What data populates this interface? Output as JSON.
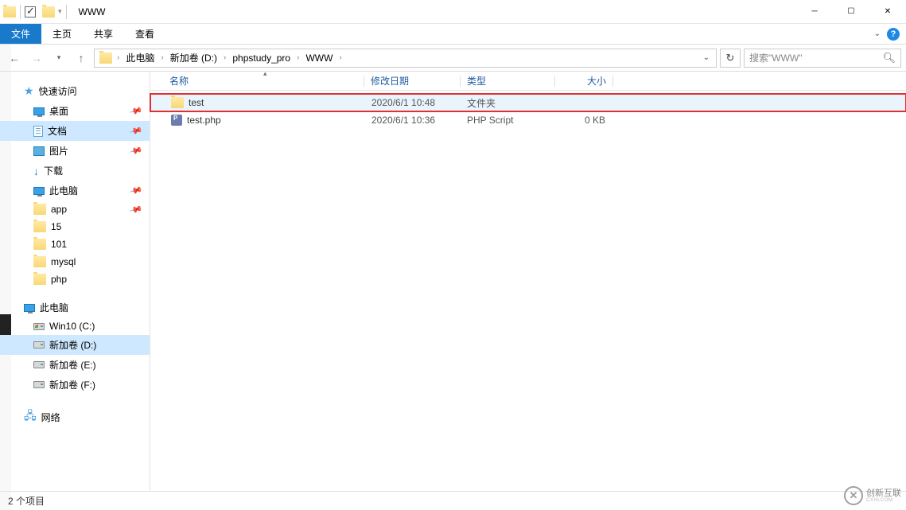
{
  "window": {
    "title": "WWW"
  },
  "ribbon": {
    "file": "文件",
    "tabs": [
      "主页",
      "共享",
      "查看"
    ]
  },
  "breadcrumbs": [
    "此电脑",
    "新加卷 (D:)",
    "phpstudy_pro",
    "WWW"
  ],
  "search": {
    "placeholder": "搜索\"WWW\""
  },
  "nav": {
    "quick_access": "快速访问",
    "quick_items": [
      {
        "label": "桌面",
        "icon": "monitor",
        "pinned": true
      },
      {
        "label": "文档",
        "icon": "doc",
        "pinned": true,
        "selected": true
      },
      {
        "label": "图片",
        "icon": "pic",
        "pinned": true
      },
      {
        "label": "下载",
        "icon": "down",
        "pinned": false
      },
      {
        "label": "此电脑",
        "icon": "monitor",
        "pinned": true
      },
      {
        "label": "app",
        "icon": "folder",
        "pinned": true
      },
      {
        "label": "15",
        "icon": "folder",
        "pinned": false
      },
      {
        "label": "101",
        "icon": "folder",
        "pinned": false
      },
      {
        "label": "mysql",
        "icon": "folder",
        "pinned": false
      },
      {
        "label": "php",
        "icon": "folder",
        "pinned": false
      }
    ],
    "this_pc": "此电脑",
    "drives": [
      {
        "label": "Win10 (C:)",
        "win": true
      },
      {
        "label": "新加卷 (D:)",
        "selected": true
      },
      {
        "label": "新加卷 (E:)"
      },
      {
        "label": "新加卷 (F:)"
      }
    ],
    "network": "网络"
  },
  "columns": {
    "name": "名称",
    "date": "修改日期",
    "type": "类型",
    "size": "大小"
  },
  "files": [
    {
      "name": "test",
      "date": "2020/6/1 10:48",
      "type": "文件夹",
      "size": "",
      "icon": "folder",
      "highlighted": true
    },
    {
      "name": "test.php",
      "date": "2020/6/1 10:36",
      "type": "PHP Script",
      "size": "0 KB",
      "icon": "php"
    }
  ],
  "status": {
    "count": "2 个项目"
  },
  "watermark": {
    "brand": "创新互联",
    "sub": "CXHLCOM"
  }
}
